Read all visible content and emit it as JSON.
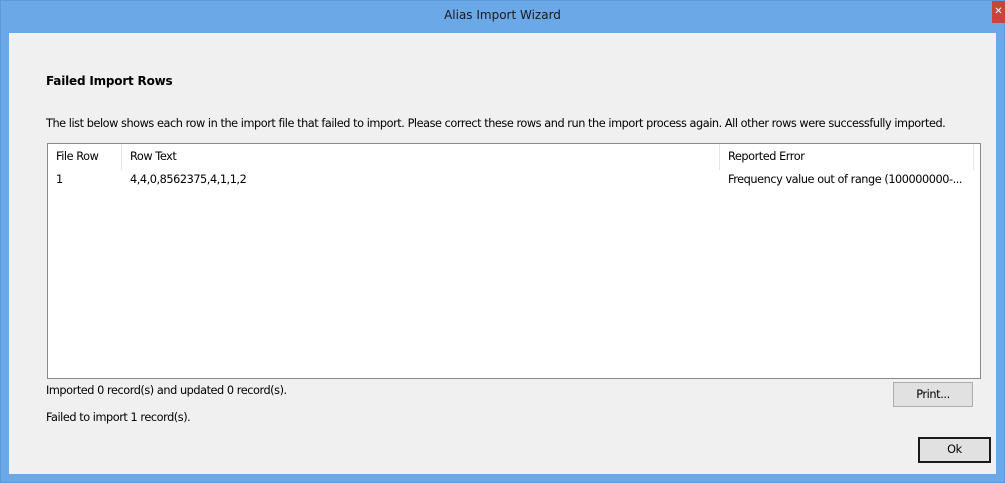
{
  "window": {
    "title": "Alias Import Wizard",
    "close_glyph": "✕"
  },
  "section": {
    "title": "Failed Import Rows",
    "description": "The list below shows each row in the import file that failed to import.  Please correct these rows and run the import process again.  All other rows were successfully imported."
  },
  "grid": {
    "columns": [
      {
        "label": "File Row"
      },
      {
        "label": "Row Text"
      },
      {
        "label": "Reported Error"
      }
    ],
    "rows": [
      {
        "file_row": "1",
        "row_text": "4,4,0,8562375,4,1,1,2",
        "reported_error": "Frequency value out of range (100000000-..."
      }
    ]
  },
  "status": {
    "imported": "Imported 0 record(s) and updated 0 record(s).",
    "failed": "Failed to import 1 record(s)."
  },
  "buttons": {
    "print": "Print...",
    "ok": "Ok"
  },
  "colors": {
    "title_bar": "#6aa8e8",
    "close_button": "#c7453a",
    "client_background": "#f0f0f0"
  }
}
